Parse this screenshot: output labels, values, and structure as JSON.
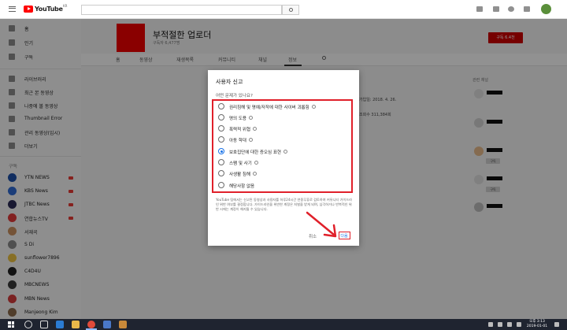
{
  "topbar": {
    "logo_text": "YouTube",
    "logo_region": "KR"
  },
  "sidebar": {
    "items": [
      {
        "label": "홈",
        "icon": "home-icon"
      },
      {
        "label": "인기",
        "icon": "trending-icon"
      },
      {
        "label": "구독",
        "icon": "subscriptions-icon"
      },
      {
        "label": "라이브러리",
        "icon": "library-icon"
      },
      {
        "label": "최근 본 동영상",
        "icon": "history-icon"
      },
      {
        "label": "나중에 볼 동영상",
        "icon": "clock-icon"
      },
      {
        "label": "Thumbnail Error",
        "icon": "playlist-icon"
      },
      {
        "label": "관리 동영상(임시)",
        "icon": "playlist-icon"
      },
      {
        "label": "더보기",
        "icon": "chevron-down-icon"
      }
    ],
    "section_subscriptions": "구독",
    "channels": [
      {
        "name": "YTN NEWS",
        "color": "#1d4fa5",
        "live": true
      },
      {
        "name": "KBS News",
        "color": "#2f6ad1",
        "live": true
      },
      {
        "name": "JTBC News",
        "color": "#2a2a55",
        "live": true
      },
      {
        "name": "연합뉴스TV",
        "color": "#e03a3a",
        "live": true
      },
      {
        "name": "서재곡",
        "color": "#c89060",
        "live": false
      },
      {
        "name": "S Di",
        "color": "#888888",
        "live": false
      },
      {
        "name": "sunflower7896",
        "color": "#e9c040",
        "live": false
      },
      {
        "name": "C4D4U",
        "color": "#222222",
        "live": false
      },
      {
        "name": "MBCNEWS",
        "color": "#3a3a3a",
        "live": false
      },
      {
        "name": "MBN News",
        "color": "#d23b3b",
        "live": false
      },
      {
        "name": "Manjeong Kim",
        "color": "#8a6a4a",
        "live": false
      }
    ]
  },
  "channel": {
    "name": "부적절한 업로더",
    "subscribers": "구독자 6,477명",
    "subscribe_label": "구독 6.4천",
    "tabs": [
      "홈",
      "동영상",
      "재생목록",
      "커뮤니티",
      "채널",
      "정보"
    ],
    "about": {
      "joined": "가입일: 2018. 4. 26.",
      "views": "조회수 311,384회"
    },
    "related_title": "관련 채널",
    "related_sub_label": "구독"
  },
  "dialog": {
    "title": "사용자 신고",
    "question": "어떤 문제가 있나요?",
    "options": [
      {
        "label": "권리침해 및 명예/저작에 대한 사이버 괴롭힘",
        "selected": false
      },
      {
        "label": "명의 도용",
        "selected": false
      },
      {
        "label": "폭력적 위협",
        "selected": false
      },
      {
        "label": "아동 학대",
        "selected": false
      },
      {
        "label": "보호집단에 대한 증오심 표현",
        "selected": true
      },
      {
        "label": "스팸 및 사기",
        "selected": false
      },
      {
        "label": "사생활 침해",
        "selected": false
      },
      {
        "label": "해당사항 없음",
        "selected": false
      }
    ],
    "note": "YouTube 팀에서는 신고된 동영상과 사용자를 하루24시간 연중무휴로 검토하여 커뮤니티 가이드라인 위반 여부를 결정합니다. 가이드라인을 위반한 계정은 처벌을 받게 되며, 심각하거나 반복적인 위반 시에는 계정이 해지될 수 있습니다.",
    "cancel_label": "취소",
    "next_label": "다음"
  },
  "taskbar": {
    "time": "오후 3:13",
    "date": "2019-01-01"
  },
  "colors": {
    "accent_red": "#e0202a",
    "brand_red": "#ff0000",
    "selected_blue": "#1a73e8"
  }
}
